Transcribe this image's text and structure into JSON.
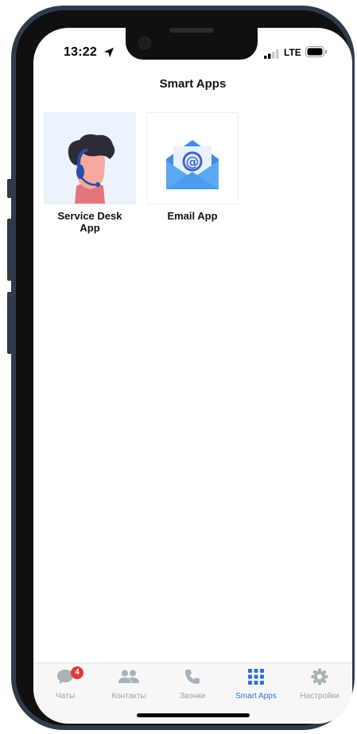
{
  "status_bar": {
    "time": "13:22",
    "network": "LTE",
    "icons": [
      "location-arrow-icon",
      "signal-icon",
      "battery-icon"
    ]
  },
  "header": {
    "title": "Smart Apps"
  },
  "apps": [
    {
      "name": "Service Desk App",
      "icon": "support-agent-icon"
    },
    {
      "name": "Email App",
      "icon": "email-envelope-icon"
    }
  ],
  "tabbar": {
    "tabs": [
      {
        "label": "Чаты",
        "icon": "chat-bubble-icon",
        "badge": "4",
        "active": false
      },
      {
        "label": "Контакты",
        "icon": "contacts-icon",
        "active": false
      },
      {
        "label": "Звонки",
        "icon": "phone-icon",
        "active": false
      },
      {
        "label": "Smart Apps",
        "icon": "apps-grid-icon",
        "active": true
      },
      {
        "label": "Настройки",
        "icon": "gear-icon",
        "active": false
      }
    ]
  },
  "colors": {
    "accent": "#2e73d8",
    "inactive": "#9aa3ad",
    "badge": "#e53935",
    "frame": "#2f3b4b"
  }
}
